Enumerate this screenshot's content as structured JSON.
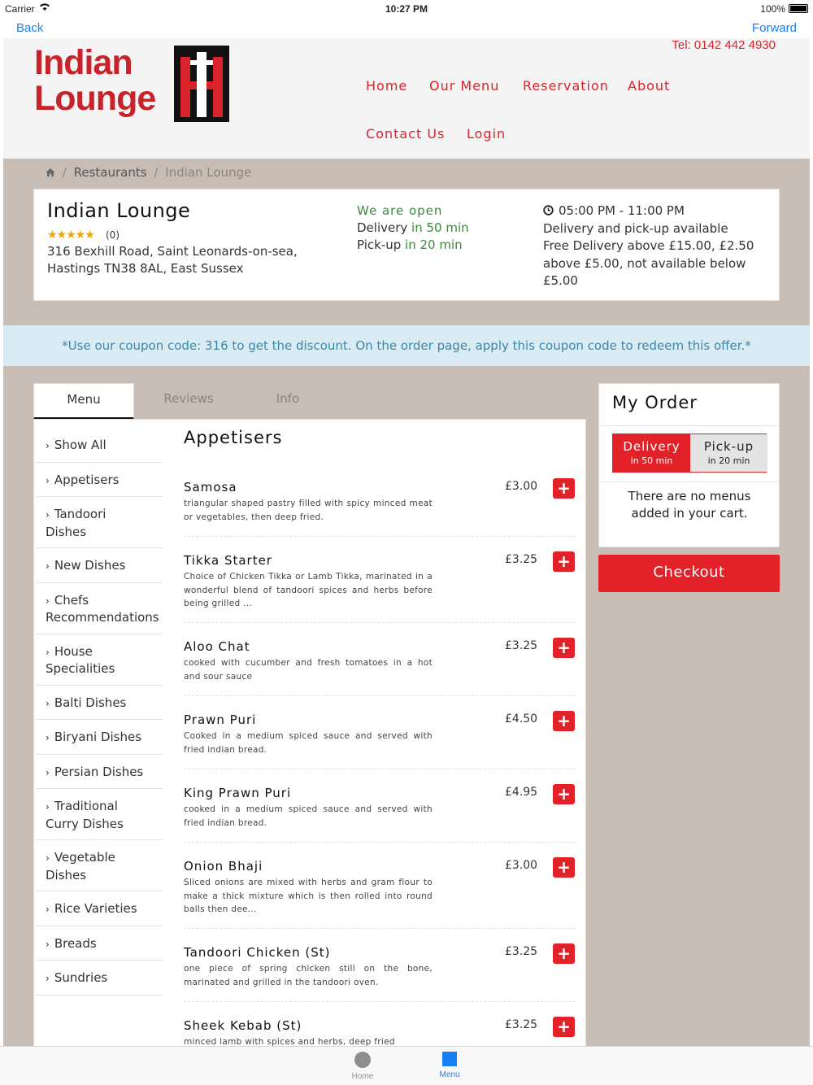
{
  "status_bar": {
    "carrier": "Carrier",
    "time": "10:27 PM",
    "battery": "100%"
  },
  "browser_nav": {
    "back": "Back",
    "forward": "Forward"
  },
  "header": {
    "logo_line1": "Indian",
    "logo_line2": "Lounge",
    "tel": "Tel: 0142 442 4930",
    "nav": [
      "Home",
      "Our Menu",
      "Reservation",
      "About",
      "Contact Us",
      "Login"
    ]
  },
  "breadcrumb": {
    "items": [
      "Restaurants",
      "Indian Lounge"
    ],
    "sep": "/"
  },
  "restaurant": {
    "name": "Indian Lounge",
    "stars": "★★★★★",
    "rating_count": "(0)",
    "address_line1": "316 Bexhill Road, Saint Leonards-on-sea,",
    "address_line2": "Hastings TN38 8AL, East Sussex",
    "open_status": "We are open",
    "delivery_label": "Delivery",
    "delivery_time": "in 50 min",
    "pickup_label": "Pick-up",
    "pickup_time": "in 20 min",
    "hours": "05:00 PM - 11:00 PM",
    "hours_icon": "clock-icon",
    "delivery_info": "Delivery and pick-up available",
    "free_delivery": "Free Delivery above £15.00, £2.50 above £5.00, not available below £5.00"
  },
  "coupon": "*Use our coupon code: 316 to get the discount. On the order page, apply this coupon code to redeem this offer.*",
  "tabs": [
    "Menu",
    "Reviews",
    "Info"
  ],
  "sidebar": {
    "items": [
      {
        "l1": "Show All",
        "l2": ""
      },
      {
        "l1": "Appetisers",
        "l2": ""
      },
      {
        "l1": "Tandoori",
        "l2": "Dishes"
      },
      {
        "l1": "New Dishes",
        "l2": ""
      },
      {
        "l1": "Chefs",
        "l2": "Recommendations"
      },
      {
        "l1": "House",
        "l2": "Specialities"
      },
      {
        "l1": "Balti Dishes",
        "l2": ""
      },
      {
        "l1": "Biryani Dishes",
        "l2": ""
      },
      {
        "l1": "Persian Dishes",
        "l2": ""
      },
      {
        "l1": "Traditional",
        "l2": "Curry Dishes"
      },
      {
        "l1": "Vegetable",
        "l2": "Dishes"
      },
      {
        "l1": "Rice Varieties",
        "l2": ""
      },
      {
        "l1": "Breads",
        "l2": ""
      },
      {
        "l1": "Sundries",
        "l2": ""
      }
    ]
  },
  "menu": {
    "category": "Appetisers",
    "dishes": [
      {
        "name": "Samosa",
        "desc": "triangular shaped pastry filled with spicy minced meat or vegetables, then deep fried.",
        "price": "£3.00"
      },
      {
        "name": "Tikka Starter",
        "desc": "Choice of Chicken Tikka or Lamb Tikka, marinated in a wonderful blend of tandoori spices and herbs before being grilled ...",
        "price": "£3.25"
      },
      {
        "name": "Aloo Chat",
        "desc": "cooked with cucumber and fresh tomatoes in a hot and sour sauce",
        "price": "£3.25"
      },
      {
        "name": "Prawn Puri",
        "desc": "Cooked in a medium spiced sauce and served with fried indian bread.",
        "price": "£4.50"
      },
      {
        "name": "King Prawn Puri",
        "desc": "cooked in a medium spiced sauce and served with fried indian bread.",
        "price": "£4.95"
      },
      {
        "name": "Onion Bhaji",
        "desc": "Sliced onions are mixed with herbs and gram flour to make a thick mixture which is then rolled into round balls then dee...",
        "price": "£3.00"
      },
      {
        "name": "Tandoori Chicken (St)",
        "desc": "one piece of spring chicken still on the bone, marinated and grilled in the tandoori oven.",
        "price": "£3.25"
      },
      {
        "name": "Sheek Kebab (St)",
        "desc": "minced lamb with spices and herbs, deep fried",
        "price": "£3.25"
      }
    ],
    "add_symbol": "+"
  },
  "order": {
    "title": "My Order",
    "delivery_label": "Delivery",
    "delivery_time": "in 50 min",
    "pickup_label": "Pick-up",
    "pickup_time": "in 20 min",
    "empty_text": "There are no menus added in your cart.",
    "checkout": "Checkout"
  },
  "tabbar": {
    "home": "Home",
    "menu": "Menu"
  },
  "colors": {
    "brand_red": "#e32128",
    "ios_blue": "#1a7ff5",
    "open_green": "#3b8a3b",
    "coupon_text": "#3a87ad"
  }
}
